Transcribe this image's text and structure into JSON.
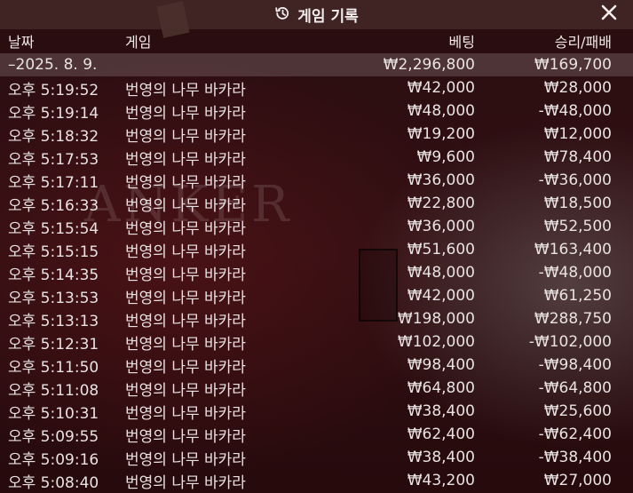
{
  "window": {
    "title": "게임 기록",
    "icon": "history-icon",
    "close_icon": "close-icon"
  },
  "columns": {
    "date": "날짜",
    "game": "게임",
    "bet": "베팅",
    "win_loss": "승리/패배"
  },
  "summary": {
    "date": "–2025. 8. 9.",
    "bet": "₩2,296,800",
    "win_loss": "₩169,700"
  },
  "rows": [
    {
      "time": "오후 5:19:52",
      "game": "번영의 나무 바카라",
      "bet": "₩42,000",
      "win_loss": "₩28,000"
    },
    {
      "time": "오후 5:19:14",
      "game": "번영의 나무 바카라",
      "bet": "₩48,000",
      "win_loss": "-₩48,000"
    },
    {
      "time": "오후 5:18:32",
      "game": "번영의 나무 바카라",
      "bet": "₩19,200",
      "win_loss": "₩12,000"
    },
    {
      "time": "오후 5:17:53",
      "game": "번영의 나무 바카라",
      "bet": "₩9,600",
      "win_loss": "₩78,400"
    },
    {
      "time": "오후 5:17:11",
      "game": "번영의 나무 바카라",
      "bet": "₩36,000",
      "win_loss": "-₩36,000"
    },
    {
      "time": "오후 5:16:33",
      "game": "번영의 나무 바카라",
      "bet": "₩22,800",
      "win_loss": "₩18,500"
    },
    {
      "time": "오후 5:15:54",
      "game": "번영의 나무 바카라",
      "bet": "₩36,000",
      "win_loss": "₩52,500"
    },
    {
      "time": "오후 5:15:15",
      "game": "번영의 나무 바카라",
      "bet": "₩51,600",
      "win_loss": "₩163,400"
    },
    {
      "time": "오후 5:14:35",
      "game": "번영의 나무 바카라",
      "bet": "₩48,000",
      "win_loss": "-₩48,000"
    },
    {
      "time": "오후 5:13:53",
      "game": "번영의 나무 바카라",
      "bet": "₩42,000",
      "win_loss": "₩61,250"
    },
    {
      "time": "오후 5:13:13",
      "game": "번영의 나무 바카라",
      "bet": "₩198,000",
      "win_loss": "₩288,750"
    },
    {
      "time": "오후 5:12:31",
      "game": "번영의 나무 바카라",
      "bet": "₩102,000",
      "win_loss": "-₩102,000"
    },
    {
      "time": "오후 5:11:50",
      "game": "번영의 나무 바카라",
      "bet": "₩98,400",
      "win_loss": "-₩98,400"
    },
    {
      "time": "오후 5:11:08",
      "game": "번영의 나무 바카라",
      "bet": "₩64,800",
      "win_loss": "-₩64,800"
    },
    {
      "time": "오후 5:10:31",
      "game": "번영의 나무 바카라",
      "bet": "₩38,400",
      "win_loss": "₩25,600"
    },
    {
      "time": "오후 5:09:55",
      "game": "번영의 나무 바카라",
      "bet": "₩62,400",
      "win_loss": "-₩62,400"
    },
    {
      "time": "오후 5:09:16",
      "game": "번영의 나무 바카라",
      "bet": "₩38,400",
      "win_loss": "-₩38,400"
    },
    {
      "time": "오후 5:08:40",
      "game": "번영의 나무 바카라",
      "bet": "₩43,200",
      "win_loss": "₩27,000"
    }
  ]
}
